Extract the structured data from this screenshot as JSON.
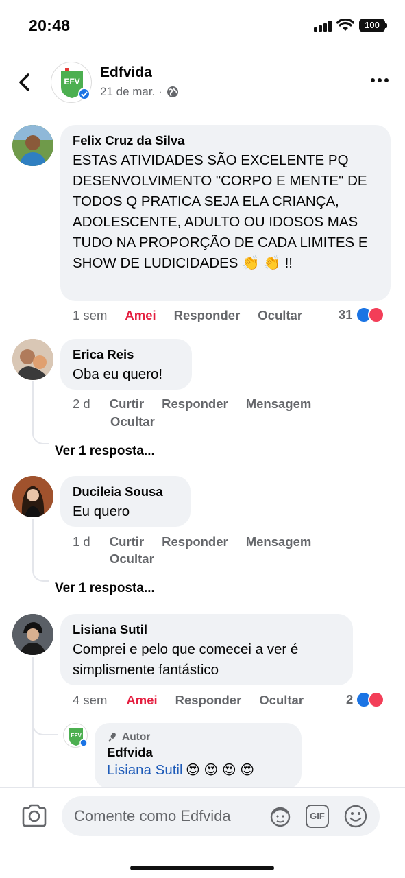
{
  "status_bar": {
    "time": "20:48",
    "battery": "100"
  },
  "header": {
    "page_name": "Edfvida",
    "date": "21 de mar. ·",
    "avatar_text": "EFV"
  },
  "comments": [
    {
      "author": "Felix Cruz da Silva",
      "text": "ESTAS ATIVIDADES SÃO EXCELENTE PQ DESENVOLVIMENTO \"CORPO E MENTE\" DE TODOS Q PRATICA SEJA ELA CRIANÇA, ADOLESCENTE, ADULTO OU IDOSOS MAS TUDO NA PROPORÇÃO DE CADA LIMITES E SHOW DE LUDICIDADES 👏 👏 !!",
      "time": "1 sem",
      "reaction_label": "Amei",
      "reply_label": "Responder",
      "hide_label": "Ocultar",
      "reaction_count": "31"
    },
    {
      "author": "Erica Reis",
      "text": "Oba eu quero!",
      "time": "2 d",
      "like_label": "Curtir",
      "reply_label": "Responder",
      "message_label": "Mensagem",
      "hide_label": "Ocultar",
      "more_replies": "Ver 1 resposta..."
    },
    {
      "author": "Ducileia Sousa",
      "text": "Eu quero",
      "time": "1 d",
      "like_label": "Curtir",
      "reply_label": "Responder",
      "message_label": "Mensagem",
      "hide_label": "Ocultar",
      "more_replies": "Ver 1 resposta..."
    },
    {
      "author": "Lisiana Sutil",
      "text": "Comprei e pelo que comecei a ver é simplismente fantástico",
      "time": "4 sem",
      "reaction_label": "Amei",
      "reply_label": "Responder",
      "hide_label": "Ocultar",
      "reaction_count": "2"
    }
  ],
  "reply": {
    "badge": "Autor",
    "author": "Edfvida",
    "mention": "Lisiana Sutil",
    "emojis": "😍 😍 😍 😍"
  },
  "composer": {
    "placeholder": "Comente como Edfvida",
    "gif_label": "GIF"
  },
  "colors": {
    "accent": "#1b74e4",
    "love": "#e41e3f",
    "bubble": "#f0f2f5",
    "muted": "#65676b"
  }
}
